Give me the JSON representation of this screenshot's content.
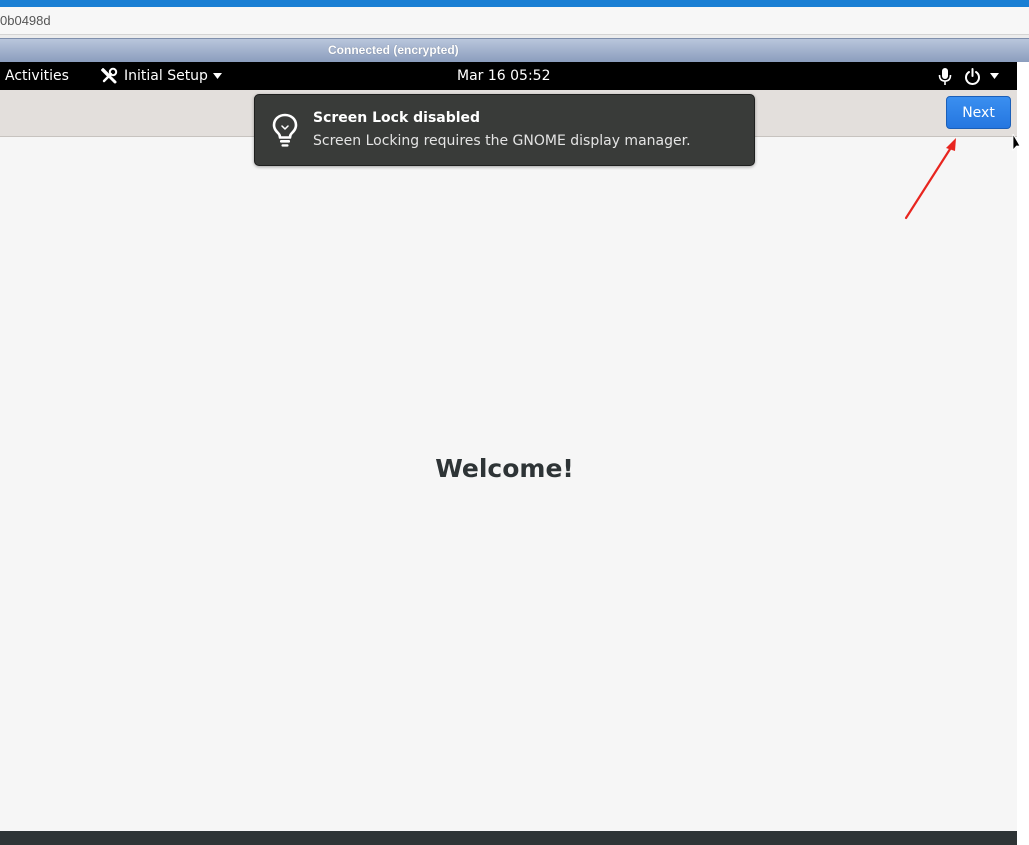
{
  "browser": {
    "url_fragment": "0b0498d",
    "connection_status": "Connected (encrypted)",
    "accent_color": "#1a7fd4"
  },
  "topbar": {
    "activities_label": "Activities",
    "app_menu_label": "Initial Setup",
    "app_menu_icon": "tools-icon",
    "clock": "Mar 16  05:52",
    "tray_icons": [
      "microphone-icon",
      "power-icon",
      "chevron-down-icon"
    ]
  },
  "notification": {
    "icon": "lightbulb-icon",
    "title": "Screen Lock disabled",
    "body": "Screen Locking requires the GNOME display manager."
  },
  "setup": {
    "next_label": "Next",
    "welcome_heading": "Welcome!",
    "primary_color": "#2a7de3"
  },
  "annotation": {
    "color": "#e8251f",
    "points_to": "next-button"
  }
}
